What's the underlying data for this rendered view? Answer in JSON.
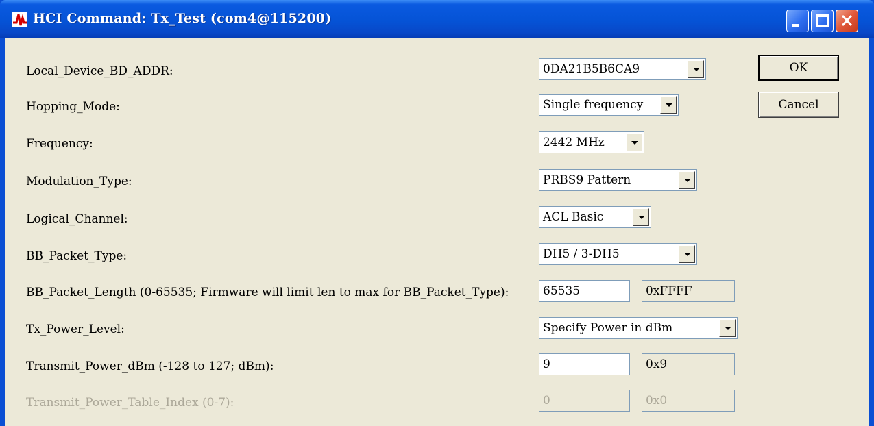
{
  "window": {
    "title": "HCI Command: Tx_Test (com4@115200)"
  },
  "buttons": {
    "ok": "OK",
    "cancel": "Cancel"
  },
  "fields": {
    "local_device_bd_addr": {
      "label": "Local_Device_BD_ADDR:",
      "value": "0DA21B5B6CA9"
    },
    "hopping_mode": {
      "label": "Hopping_Mode:",
      "value": "Single frequency"
    },
    "frequency": {
      "label": "Frequency:",
      "value": "2442 MHz"
    },
    "modulation_type": {
      "label": "Modulation_Type:",
      "value": "PRBS9 Pattern"
    },
    "logical_channel": {
      "label": "Logical_Channel:",
      "value": "ACL Basic"
    },
    "bb_packet_type": {
      "label": "BB_Packet_Type:",
      "value": "DH5 / 3-DH5"
    },
    "bb_packet_length": {
      "label": "BB_Packet_Length (0-65535; Firmware will limit len to max for BB_Packet_Type):",
      "value": "65535",
      "hex": "0xFFFF"
    },
    "tx_power_level": {
      "label": "Tx_Power_Level:",
      "value": "Specify Power in dBm"
    },
    "transmit_power_dbm": {
      "label": "Transmit_Power_dBm (-128 to 127; dBm):",
      "value": "9",
      "hex": "0x9"
    },
    "transmit_power_table_index": {
      "label": "Transmit_Power_Table_Index (0-7):",
      "value": "0",
      "hex": "0x0"
    }
  },
  "icons": {
    "app": "waveform-app-icon",
    "minimize": "minimize-icon",
    "maximize": "maximize-icon",
    "close": "close-icon"
  },
  "colors": {
    "titlebar": "#0553d6",
    "client_bg": "#ece9d8",
    "close_button": "#e0583a",
    "disabled_text": "#aca899"
  }
}
